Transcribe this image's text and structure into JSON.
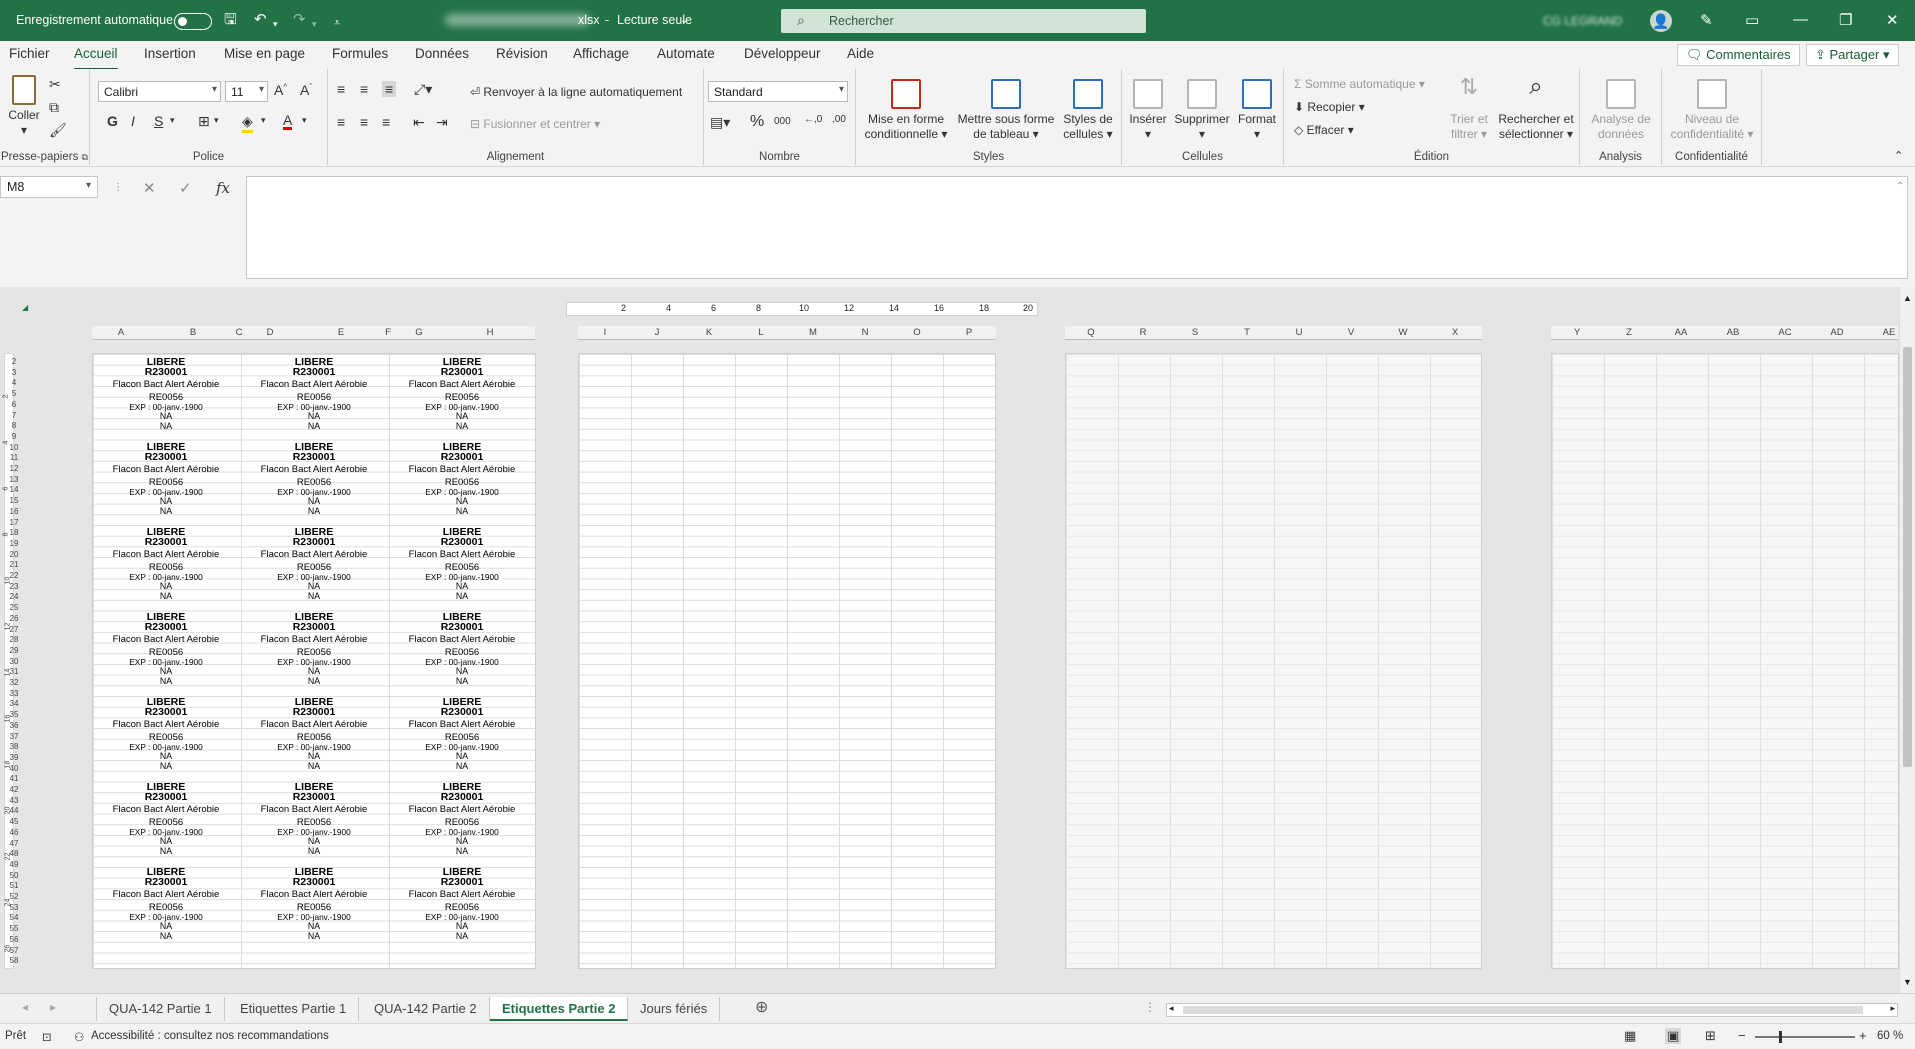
{
  "titlebar": {
    "autosave_label": "Enregistrement automatique",
    "doc_suffix": "xlsx",
    "mode": "Lecture seule",
    "search_placeholder": "Rechercher",
    "user_initials": "CG LEGRAND"
  },
  "menu": [
    "Fichier",
    "Accueil",
    "Insertion",
    "Mise en page",
    "Formules",
    "Données",
    "Révision",
    "Affichage",
    "Automate",
    "Développeur",
    "Aide"
  ],
  "menu_active": "Accueil",
  "top_buttons": {
    "comments": "Commentaires",
    "share": "Partager"
  },
  "ribbon": {
    "clipboard": {
      "paste": "Coller",
      "group": "Presse-papiers"
    },
    "font": {
      "name": "Calibri",
      "size": "11",
      "bold": "G",
      "italic": "I",
      "underline": "S",
      "group": "Police"
    },
    "alignment": {
      "wrap": "Renvoyer à la ligne automatiquement",
      "merge": "Fusionner et centrer",
      "group": "Alignement"
    },
    "number": {
      "format": "Standard",
      "group": "Nombre"
    },
    "styles": {
      "cond_l1": "Mise en forme",
      "cond_l2": "conditionnelle",
      "table_l1": "Mettre sous forme",
      "table_l2": "de tableau",
      "cell_l1": "Styles de",
      "cell_l2": "cellules",
      "group": "Styles"
    },
    "cells": {
      "insert": "Insérer",
      "delete": "Supprimer",
      "format": "Format",
      "group": "Cellules"
    },
    "editing": {
      "autosum": "Somme automatique",
      "fill": "Recopier",
      "clear": "Effacer",
      "sort_l1": "Trier et",
      "sort_l2": "filtrer",
      "find_l1": "Rechercher et",
      "find_l2": "sélectionner",
      "group": "Édition"
    },
    "analysis": {
      "l1": "Analyse de",
      "l2": "données",
      "group": "Analysis"
    },
    "privacy": {
      "l1": "Niveau de",
      "l2": "confidentialité",
      "group": "Confidentialité"
    }
  },
  "formula_bar": {
    "name_box": "M8",
    "fx": "fx",
    "value": ""
  },
  "columns_page1": [
    "A",
    "B",
    "C",
    "D",
    "E",
    "F",
    "G",
    "H"
  ],
  "columns_page2": [
    "I",
    "J",
    "K",
    "L",
    "M",
    "N",
    "O",
    "P"
  ],
  "columns_page3": [
    "Q",
    "R",
    "S",
    "T",
    "U",
    "V",
    "W",
    "X"
  ],
  "columns_page4": [
    "Y",
    "Z",
    "AA",
    "AB",
    "AC",
    "AD",
    "AE"
  ],
  "ruler_ticks": [
    "2",
    "4",
    "6",
    "8",
    "10",
    "12",
    "14",
    "16",
    "18",
    "20"
  ],
  "left_ruler": [
    "2",
    "4",
    "6",
    "8",
    "10",
    "12",
    "14",
    "16",
    "18",
    "20",
    "22",
    "24",
    "26"
  ],
  "row_numbers": [
    "2",
    "3",
    "4",
    "5",
    "6",
    "7",
    "8",
    "9",
    "10",
    "11",
    "12",
    "13",
    "14",
    "15",
    "16",
    "17",
    "18",
    "19",
    "20",
    "21",
    "22",
    "23",
    "24",
    "25",
    "26",
    "27",
    "28",
    "29",
    "30",
    "31",
    "32",
    "33",
    "34",
    "35",
    "36",
    "37",
    "38",
    "39",
    "40",
    "41",
    "42",
    "43",
    "44",
    "45",
    "46",
    "47",
    "48",
    "49",
    "50",
    "51",
    "52",
    "53",
    "54",
    "55",
    "56",
    "57",
    "58"
  ],
  "label_template": {
    "status": "LIBERE",
    "lot": "R230001",
    "product": "Flacon Bact Alert Aérobie",
    "ref": "RE0056",
    "expiry": "EXP : 00-janv.-1900",
    "field1": "NA",
    "field2": "NA"
  },
  "label_grid": {
    "rows": 7,
    "cols": 3
  },
  "sheet_tabs": [
    "QUA-142 Partie 1",
    "Etiquettes Partie 1",
    "QUA-142 Partie 2",
    "Etiquettes Partie 2",
    "Jours fériés"
  ],
  "active_tab": "Etiquettes Partie 2",
  "status": {
    "ready": "Prêt",
    "accessibility": "Accessibilité : consultez nos recommandations",
    "zoom": "60 %"
  },
  "colors": {
    "excel_green": "#217346",
    "active_green": "#185c37"
  }
}
